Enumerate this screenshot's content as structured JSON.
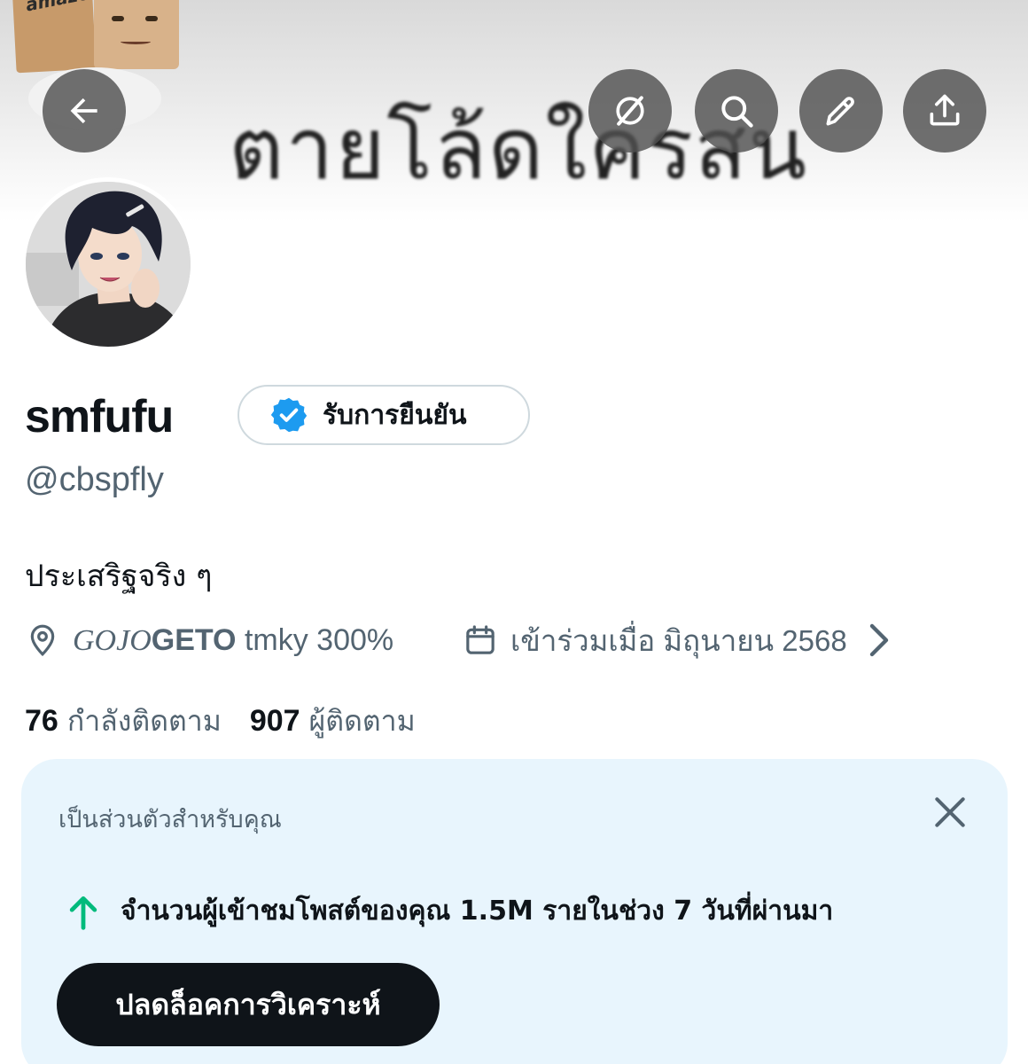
{
  "banner": {
    "box_text": "amazon",
    "text": "ตายโล้ดใครสน"
  },
  "header_buttons": {
    "back_icon": "arrow-left-icon",
    "grok_icon": "slash-circle-icon",
    "search_icon": "search-icon",
    "edit_icon": "pencil-icon",
    "share_icon": "share-upload-icon"
  },
  "profile": {
    "display_name": "smfufu",
    "handle": "@cbspfly",
    "verify_label": "รับการยืนยัน",
    "bio": "ประเสริฐจริง ๆ",
    "location_part1": "GOJO",
    "location_part2": "GETO",
    "location_part3": " tmky 300%",
    "joined": "เข้าร่วมเมื่อ มิถุนายน 2568",
    "following_count": "76",
    "following_label": "กำลังติดตาม",
    "followers_count": "907",
    "followers_label": "ผู้ติดตาม"
  },
  "card": {
    "title": "เป็นส่วนตัวสำหรับคุณ",
    "stat_line": "จำนวนผู้เข้าชมโพสต์ของคุณ 1.5M รายในช่วง 7 วันที่ผ่านมา",
    "button_label": "ปลดล็อคการวิเคราะห์"
  },
  "colors": {
    "accent_blue": "#1d9bf0",
    "muted_text": "#536471",
    "card_bg": "#e8f5fd",
    "up_arrow_green": "#00ba7c"
  }
}
